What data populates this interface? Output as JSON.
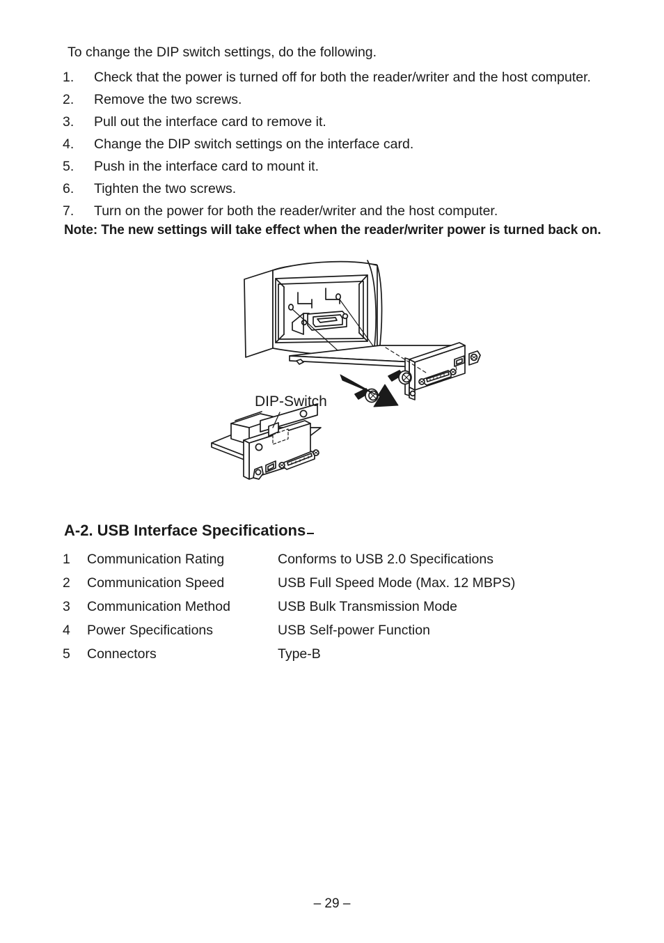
{
  "document": {
    "intro": "To change the DIP switch settings, do the following.",
    "steps": [
      {
        "num": "1.",
        "text": "Check that the power is turned off for both the reader/writer and the host computer."
      },
      {
        "num": "2.",
        "text": "Remove the two screws."
      },
      {
        "num": "3.",
        "text": "Pull out the interface card to remove it."
      },
      {
        "num": "4.",
        "text": "Change the DIP switch settings on the interface card."
      },
      {
        "num": "5.",
        "text": "Push in the interface card to mount it."
      },
      {
        "num": "6.",
        "text": "Tighten the two screws."
      },
      {
        "num": "7.",
        "text": "Turn on the power for both the reader/writer and the host computer."
      }
    ],
    "note": "Note: The new settings will take effect when the reader/writer power is turned back on.",
    "figure": {
      "callout_label": "DIP-Switch",
      "description": "Line drawing of a reader/writer rear chassis with the interface card being pulled out, two mounting screws, and a detail view of the interface card showing the DIP-switch location."
    },
    "section": {
      "heading": "A-2. USB Interface Specifications",
      "rows": [
        {
          "no": "1",
          "label": "Communication Rating",
          "value": "Conforms to USB 2.0 Specifications"
        },
        {
          "no": "2",
          "label": "Communication Speed",
          "value": "USB Full Speed Mode (Max. 12 MBPS)"
        },
        {
          "no": "3",
          "label": "Communication Method",
          "value": "USB Bulk Transmission Mode"
        },
        {
          "no": "4",
          "label": "Power Specifications",
          "value": "USB Self-power Function"
        },
        {
          "no": "5",
          "label": "Connectors",
          "value": "Type-B"
        }
      ]
    },
    "footer": {
      "page_number": "– 29 –"
    },
    "colors": {
      "text": "#1a1a1a",
      "background": "#ffffff",
      "line_art": "#1a1a1a"
    }
  }
}
